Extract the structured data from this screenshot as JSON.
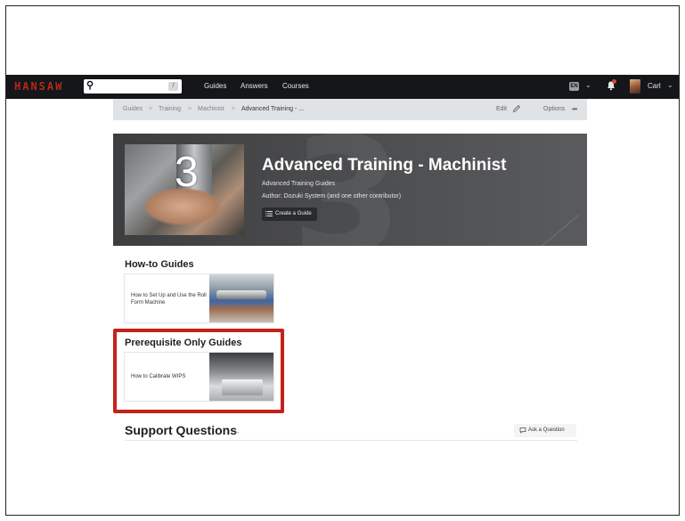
{
  "navbar": {
    "logo": "HANSAW",
    "search_shortcut": "/",
    "links": [
      "Guides",
      "Answers",
      "Courses"
    ],
    "language": "EN",
    "user_name": "Carl"
  },
  "breadcrumb": {
    "items": [
      "Guides",
      "Training",
      "Machinist",
      "Advanced Training - ..."
    ],
    "edit_label": "Edit",
    "options_label": "Options"
  },
  "hero": {
    "number": "3",
    "title": "Advanced Training - Machinist",
    "subtitle": "Advanced Training Guides",
    "author": "Author: Dozuki System (and one other contributor)",
    "create_guide_label": "Create a Guide"
  },
  "howto_section": {
    "heading": "How-to Guides",
    "guides": [
      {
        "title": "How to Set Up and Use the Roll Form Machine"
      }
    ]
  },
  "prereq_section": {
    "heading": "Prerequisite Only Guides",
    "guides": [
      {
        "title": "How to Calibrate WIPS"
      }
    ]
  },
  "support": {
    "heading": "Support Questions",
    "ask_label": "Ask a Question"
  },
  "colors": {
    "navbar_bg": "#14161a",
    "logo": "#b32a17",
    "highlight": "#c4221a",
    "breadcrumb_bg": "#dfe3e6"
  }
}
